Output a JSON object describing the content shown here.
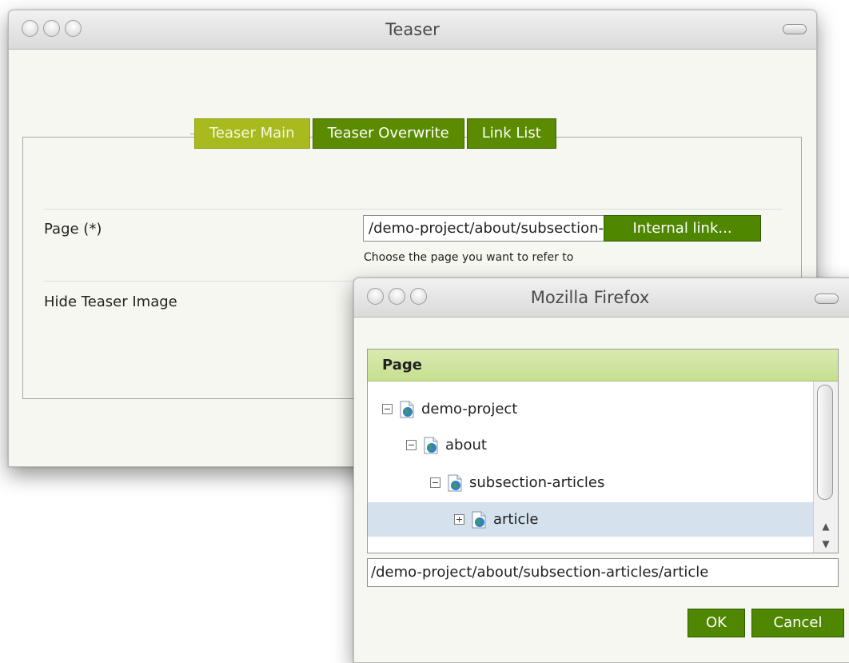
{
  "teaser_window": {
    "title": "Teaser",
    "tabs": [
      {
        "label": "Teaser Main",
        "active": true
      },
      {
        "label": "Teaser Overwrite",
        "active": false
      },
      {
        "label": "Link List",
        "active": false
      }
    ],
    "page_field": {
      "label": "Page (*)",
      "value": "/demo-project/about/subsection-articles/article",
      "button_label": "Internal link...",
      "hint": "Choose the page you want to refer to"
    },
    "hide_teaser_image_label": "Hide Teaser Image"
  },
  "firefox_dialog": {
    "title": "Mozilla Firefox",
    "tree_header": "Page",
    "tree_items": [
      {
        "label": "demo-project",
        "toggle": "collapse",
        "selected": false
      },
      {
        "label": "about",
        "toggle": "collapse",
        "selected": false
      },
      {
        "label": "subsection-articles",
        "toggle": "collapse",
        "selected": false
      },
      {
        "label": "article",
        "toggle": "expand",
        "selected": true
      }
    ],
    "path_value": "/demo-project/about/subsection-articles/article",
    "ok_label": "OK",
    "cancel_label": "Cancel"
  },
  "colors": {
    "tab_active": "#a8ba1e",
    "tab_inactive": "#5b8b00",
    "button_green": "#4f8700",
    "tree_header": "#cfe4a0",
    "selection": "#d5e2ee"
  }
}
